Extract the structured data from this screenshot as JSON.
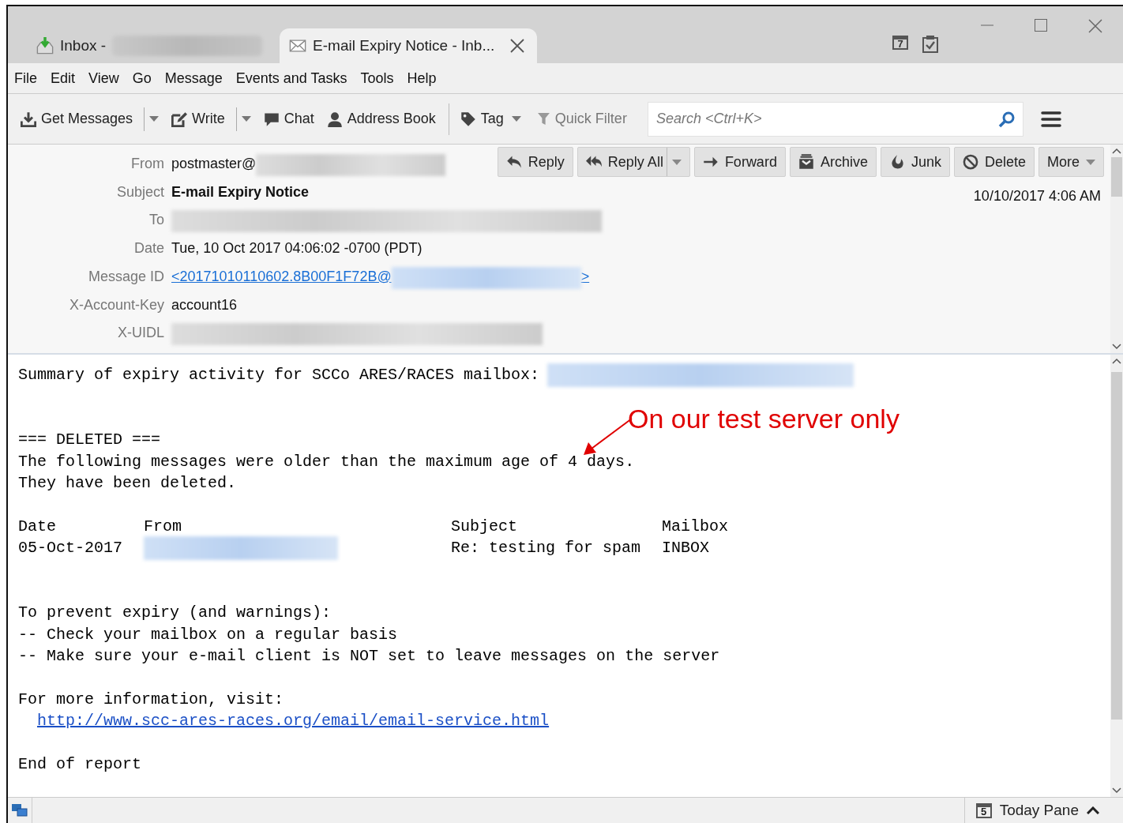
{
  "tabs": [
    {
      "label": "Inbox -",
      "redacted": true,
      "selected": false
    },
    {
      "label": "E-mail Expiry Notice - Inb...",
      "redacted": false,
      "selected": true
    }
  ],
  "title_icons": [
    {
      "kind": "calendar",
      "digit": "7"
    },
    {
      "kind": "tasks"
    }
  ],
  "menu": [
    "File",
    "Edit",
    "View",
    "Go",
    "Message",
    "Events and Tasks",
    "Tools",
    "Help"
  ],
  "toolbar": [
    {
      "label": "Get Messages",
      "dropdown": true,
      "separator_after": false,
      "disabled": false
    },
    {
      "label": "Write",
      "dropdown": true,
      "separator_after": false,
      "disabled": false
    },
    {
      "label": "Chat",
      "dropdown": false,
      "separator_after": false,
      "disabled": false
    },
    {
      "label": "Address Book",
      "dropdown": false,
      "separator_after": true,
      "disabled": false
    },
    {
      "label": "Tag",
      "dropdown": true,
      "separator_after": false,
      "disabled": false
    },
    {
      "label": "Quick Filter",
      "dropdown": false,
      "separator_after": false,
      "disabled": true
    }
  ],
  "search": {
    "placeholder": "Search <Ctrl+K>"
  },
  "header_buttons": [
    {
      "label": "Reply",
      "dropdown": false
    },
    {
      "label": "Reply All",
      "dropdown": true
    },
    {
      "label": "Forward",
      "dropdown": false
    },
    {
      "label": "Archive",
      "dropdown": false
    },
    {
      "label": "Junk",
      "dropdown": false
    },
    {
      "label": "Delete",
      "dropdown": false
    },
    {
      "label": "More",
      "dropdown": true
    }
  ],
  "received": "10/10/2017 4:06 AM",
  "headers": [
    {
      "label": "From",
      "kind": "text",
      "value": "postmaster@",
      "redacted": true
    },
    {
      "label": "Subject",
      "kind": "bold",
      "value": "E-mail Expiry Notice",
      "redacted": false
    },
    {
      "label": "To",
      "kind": "text",
      "redacted": true
    },
    {
      "label": "Date",
      "kind": "text",
      "value": "Tue, 10 Oct 2017 04:06:02 -0700 (PDT)",
      "redacted": false
    },
    {
      "label": "Message ID",
      "kind": "link",
      "value": "<20171010110602.8B00F1F72B@",
      "redacted": true,
      "suffix": ">"
    },
    {
      "label": "X-Account-Key",
      "kind": "text",
      "value": "account16",
      "redacted": false
    },
    {
      "label": "X-UIDL",
      "kind": "text",
      "redacted": true
    }
  ],
  "body": [
    {
      "kind": "text",
      "text": "Summary of expiry activity for SCCo ARES/RACES mailbox:",
      "redacted": true
    },
    {
      "kind": "blank"
    },
    {
      "kind": "blank"
    },
    {
      "kind": "text",
      "text": "=== DELETED ===",
      "redacted": false
    },
    {
      "kind": "text",
      "text": "The following messages were older than the maximum age of 4 days.",
      "redacted": false
    },
    {
      "kind": "text",
      "text": "They have been deleted.",
      "redacted": false
    },
    {
      "kind": "blank"
    },
    {
      "kind": "table_header",
      "cells": [
        "Date",
        "From",
        "Subject",
        "Mailbox"
      ]
    },
    {
      "kind": "table_row",
      "cells": [
        "05-Oct-2017",
        "",
        "Re: testing for spam",
        "INBOX"
      ]
    },
    {
      "kind": "blank"
    },
    {
      "kind": "blank"
    },
    {
      "kind": "text",
      "text": "To prevent expiry (and warnings):",
      "redacted": false
    },
    {
      "kind": "text",
      "text": "-- Check your mailbox on a regular basis",
      "redacted": false
    },
    {
      "kind": "text",
      "text": "-- Make sure your e-mail client is NOT set to leave messages on the server",
      "redacted": false
    },
    {
      "kind": "blank"
    },
    {
      "kind": "text",
      "text": "For more information, visit:",
      "redacted": false
    },
    {
      "kind": "link",
      "text": "http://www.scc-ares-races.org/email/email-service.html"
    },
    {
      "kind": "blank"
    },
    {
      "kind": "text",
      "text": "End of report",
      "redacted": false
    }
  ],
  "annotation": {
    "text": "On our test server only",
    "color": "#e00000"
  },
  "status_bar": {
    "today_pane": "Today Pane",
    "digit": "5"
  }
}
